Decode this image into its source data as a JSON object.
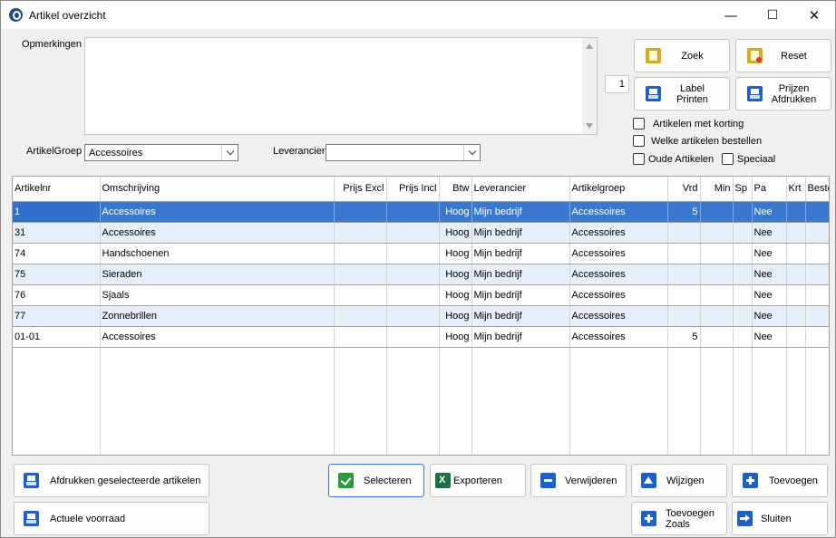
{
  "window": {
    "title": "Artikel overzicht",
    "minimize": "—",
    "maximize": "☐",
    "close": "✕"
  },
  "form": {
    "opmerkingen_label": "Opmerkingen",
    "opmerkingen_value": "",
    "artikelgroep_label": "ArtikelGroep",
    "artikelgroep_value": "Accessoires",
    "leverancier_label": "Leverancier",
    "leverancier_value": "",
    "label_count": "1"
  },
  "buttons": {
    "zoek": "Zoek",
    "reset": "Reset",
    "label_printen": [
      "Label",
      "Printen"
    ],
    "prijzen_afdrukken": [
      "Prijzen",
      "Afdrukken"
    ],
    "afdrukken_geselecteerde": "Afdrukken geselecteerde artikelen",
    "actuele_voorraad": "Actuele voorraad",
    "selecteren": "Selecteren",
    "exporteren": "Exporteren",
    "verwijderen": "Verwijderen",
    "wijzigen": "Wijzigen",
    "toevoegen": "Toevoegen",
    "toevoegen_zoals": [
      "Toevoegen",
      "Zoals"
    ],
    "sluiten": "Sluiten"
  },
  "checkboxes": {
    "met_korting": {
      "label": "Artikelen met korting",
      "checked": false
    },
    "bestellen": {
      "label": "Welke artikelen bestellen",
      "checked": false
    },
    "oude": {
      "label": "Oude Artikelen",
      "checked": false
    },
    "speciaal": {
      "label": "Speciaal",
      "checked": false
    }
  },
  "grid": {
    "columns": [
      "Artikelnr",
      "Omschrijving",
      "Prijs Excl",
      "Prijs Incl",
      "Btw",
      "Leverancier",
      "Artikelgroep",
      "Vrd",
      "Min",
      "Sp",
      "Pa",
      "Krt",
      "Beste"
    ],
    "rows": [
      [
        "1",
        "Accessoires",
        "",
        "",
        "Hoog",
        "Mijn bedrijf",
        "Accessoires",
        "5",
        "",
        "",
        "Nee",
        "",
        ""
      ],
      [
        "31",
        "Accessoires",
        "",
        "",
        "Hoog",
        "Mijn bedrijf",
        "Accessoires",
        "",
        "",
        "",
        "Nee",
        "",
        ""
      ],
      [
        "74",
        "Handschoenen",
        "",
        "",
        "Hoog",
        "Mijn bedrijf",
        "Accessoires",
        "",
        "",
        "",
        "Nee",
        "",
        ""
      ],
      [
        "75",
        "Sieraden",
        "",
        "",
        "Hoog",
        "Mijn bedrijf",
        "Accessoires",
        "",
        "",
        "",
        "Nee",
        "",
        ""
      ],
      [
        "76",
        "Sjaals",
        "",
        "",
        "Hoog",
        "Mijn bedrijf",
        "Accessoires",
        "",
        "",
        "",
        "Nee",
        "",
        ""
      ],
      [
        "77",
        "Zonnebrillen",
        "",
        "",
        "Hoog",
        "Mijn bedrijf",
        "Accessoires",
        "",
        "",
        "",
        "Nee",
        "",
        ""
      ],
      [
        "01-01",
        "Accessoires",
        "",
        "",
        "Hoog",
        "Mijn bedrijf",
        "Accessoires",
        "5",
        "",
        "",
        "Nee",
        "",
        ""
      ]
    ],
    "selected_row": 0
  },
  "colors": {
    "selection": "#3a78d0",
    "alt_row": "#e6eefa",
    "window_bg": "#f0f0f0"
  }
}
